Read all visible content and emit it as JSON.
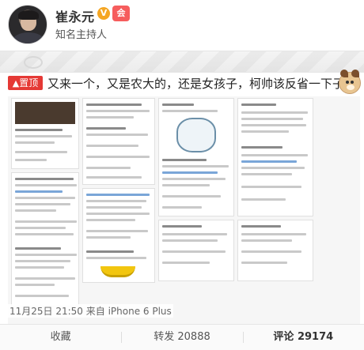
{
  "header": {
    "username": "崔永元",
    "verified_badge": "V",
    "vip_badge": "会",
    "user_title": "知名主持人"
  },
  "post": {
    "pin_label": "置顶",
    "text": "又来一个，又是农大的，还是女孩子，柯帅该反省一下子。",
    "emoji": "dog-face-emoji"
  },
  "meta": {
    "timestamp": "11月25日 21:50",
    "source": "来自 iPhone 6 Plus"
  },
  "actions": {
    "favorite_label": "收藏",
    "repost_label": "转发",
    "repost_count": "20888",
    "comment_label": "评论",
    "comment_count": "29174"
  },
  "colors": {
    "pin_red": "#e53935",
    "verified_orange": "#f5a623",
    "vip_red": "#f65d5d"
  }
}
